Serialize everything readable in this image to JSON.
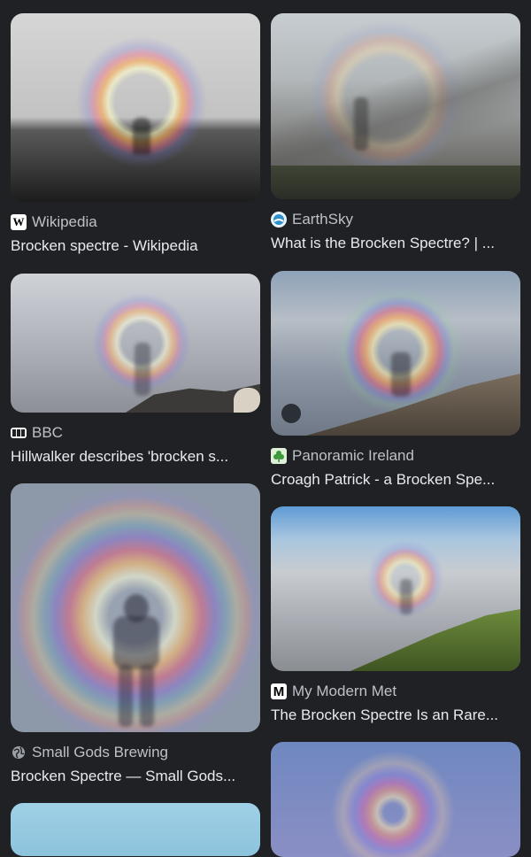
{
  "results": [
    {
      "source": "Wikipedia",
      "title": "Brocken spectre - Wikipedia",
      "favicon": "wikipedia-w-icon"
    },
    {
      "source": "EarthSky",
      "title": "What is the Brocken Spectre? | ...",
      "favicon": "earthsky-icon"
    },
    {
      "source": "BBC",
      "title": "Hillwalker describes 'brocken s...",
      "favicon": "bbc-icon"
    },
    {
      "source": "Panoramic Ireland",
      "title": "Croagh Patrick - a Brocken Spe...",
      "favicon": "shamrock-icon"
    },
    {
      "source": "Small Gods Brewing",
      "title": "Brocken Spectre — Small Gods...",
      "favicon": "globe-icon"
    },
    {
      "source": "My Modern Met",
      "title": "The Brocken Spectre Is an Rare...",
      "favicon": "mymodernmet-m-icon"
    }
  ]
}
